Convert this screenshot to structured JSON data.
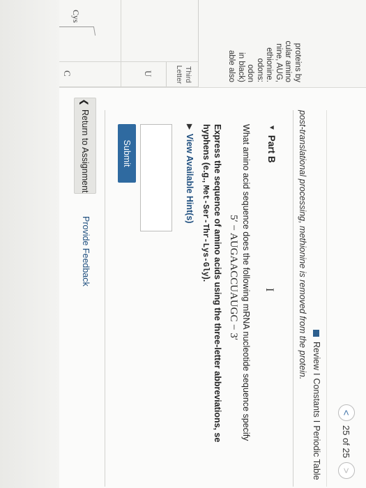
{
  "sidebar": {
    "lines": [
      "proteins by",
      "cular amino",
      "nine, AUG,",
      "ethionine.",
      "odons:",
      "odon",
      "in black)",
      "able also"
    ],
    "table": {
      "column_header": "Third Letter",
      "letters": [
        "U",
        "C"
      ],
      "amino_acid": "Cys"
    }
  },
  "nav": {
    "counter": "25 of 25",
    "prev_icon": "<",
    "next_icon": ">"
  },
  "links": {
    "review": "Review",
    "sep": "I",
    "constants": "Constants",
    "periodic_table": "Periodic Table"
  },
  "note": "post-translational processing, methionine is removed from the protein.",
  "part": {
    "label": "Part B",
    "question": "What amino acid sequence does the following mRNA nucleotide sequence specify",
    "sequence": "5′ − AUGAACCUAUGC − 3′",
    "instruction_prefix": "Express the sequence of amino acids using the three-letter abbreviations, se",
    "instruction_line2": "hyphens (e.g., ",
    "example": "Met-Ser-Thr-Lys-Gly",
    "instruction_suffix": ").",
    "hint_link": "View Available Hint(s)",
    "answer_value": "",
    "submit_label": "Submit"
  },
  "footer": {
    "return_label": "Return to Assignment",
    "feedback_label": "Provide Feedback"
  },
  "colors": {
    "accent": "#2f6aa0",
    "link": "#1f4f7f"
  }
}
